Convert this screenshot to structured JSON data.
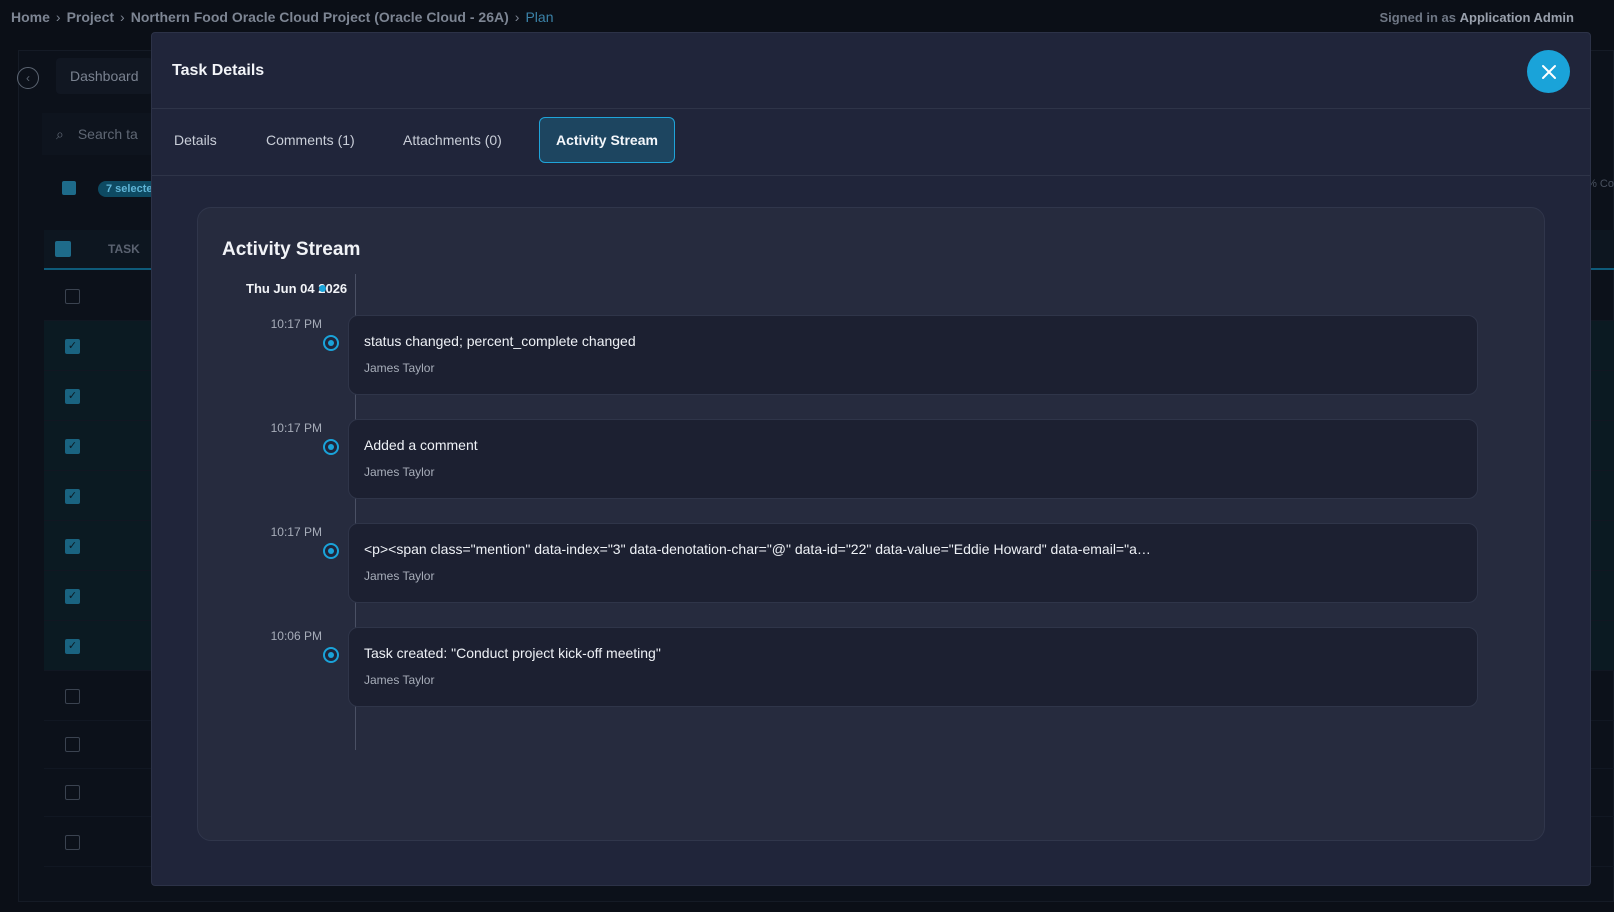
{
  "breadcrumb": {
    "home": "Home",
    "project": "Project",
    "project_name": "Northern Food Oracle Cloud Project (Oracle Cloud - 26A)",
    "current": "Plan"
  },
  "signed_in": {
    "prefix": "Signed in as",
    "user": "Application Admin"
  },
  "background": {
    "dashboard_label": "Dashboard",
    "search_placeholder": "Search ta",
    "selected_pill": "7 selecte",
    "table_header_task": "TASK",
    "right_fragment": "% Co"
  },
  "modal": {
    "title": "Task Details",
    "tabs": [
      {
        "label": "Details"
      },
      {
        "label": "Comments (1)"
      },
      {
        "label": "Attachments (0)"
      },
      {
        "label": "Activity Stream"
      }
    ],
    "activity": {
      "title": "Activity Stream",
      "date": "Thu Jun 04 2026",
      "entries": [
        {
          "time": "10:17 PM",
          "text": "status changed; percent_complete changed",
          "user": "James Taylor"
        },
        {
          "time": "10:17 PM",
          "text": "Added a comment",
          "user": "James Taylor"
        },
        {
          "time": "10:17 PM",
          "text": "<p><span class=\"mention\" data-index=\"3\" data-denotation-char=\"@\" data-id=\"22\" data-value=\"Eddie Howard\" data-email=\"a…",
          "user": "James Taylor"
        },
        {
          "time": "10:06 PM",
          "text": "Task created: \"Conduct project kick-off meeting\"",
          "user": "James Taylor"
        }
      ]
    }
  },
  "colors": {
    "accent": "#1aa3d9",
    "modal_bg": "#20253a",
    "card_bg": "#262b3e"
  }
}
